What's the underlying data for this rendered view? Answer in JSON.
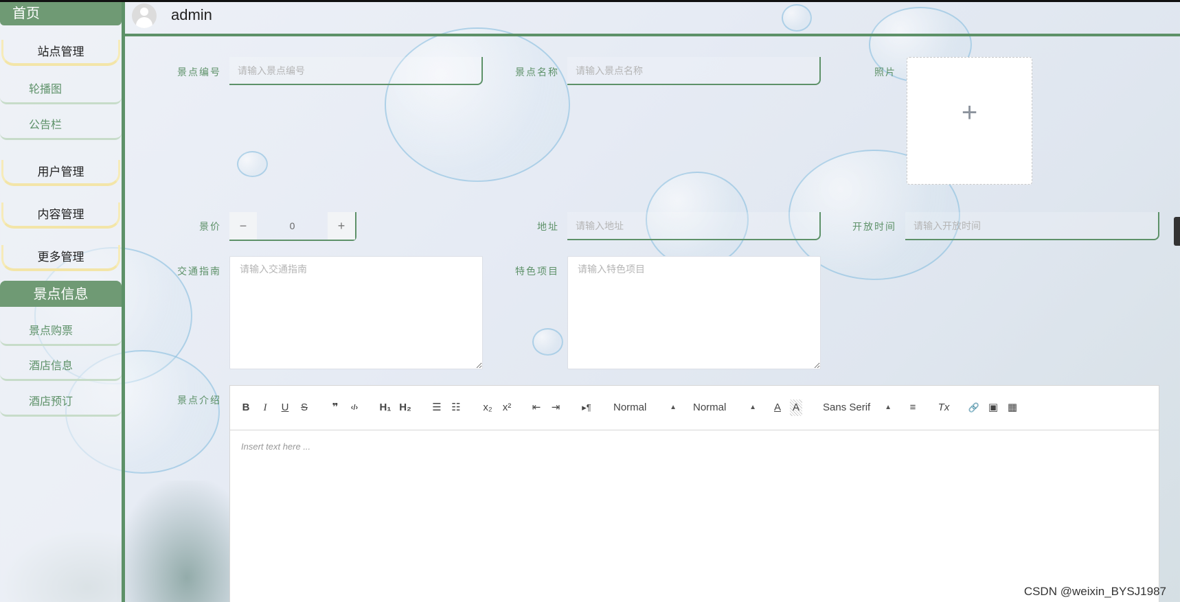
{
  "sidebar": {
    "home": "首页",
    "groups": [
      {
        "label": "站点管理",
        "items": [
          "轮播图",
          "公告栏"
        ]
      },
      {
        "label": "用户管理"
      },
      {
        "label": "内容管理"
      },
      {
        "label": "更多管理"
      }
    ],
    "active_section": "景点信息",
    "active_items": [
      "景点购票",
      "酒店信息",
      "酒店预订"
    ]
  },
  "header": {
    "username": "admin"
  },
  "form": {
    "id_label": "景点编号",
    "id_placeholder": "请输入景点编号",
    "name_label": "景点名称",
    "name_placeholder": "请输入景点名称",
    "photo_label": "照片",
    "photo_upload_icon": "+",
    "price_label": "景价",
    "price_value": "0",
    "price_minus": "−",
    "price_plus": "+",
    "address_label": "地址",
    "address_placeholder": "请输入地址",
    "hours_label": "开放时间",
    "hours_placeholder": "请输入开放时间",
    "traffic_label": "交通指南",
    "traffic_placeholder": "请输入交通指南",
    "feature_label": "特色项目",
    "feature_placeholder": "请输入特色项目",
    "intro_label": "景点介绍"
  },
  "editor": {
    "toolbar": {
      "bold": "B",
      "italic": "I",
      "underline": "U",
      "strike": "S",
      "quote": "❞",
      "code": "‹/›",
      "h1": "H₁",
      "h2": "H₂",
      "ordered_list": "☰",
      "bullet_list": "☷",
      "subscript": "x₂",
      "superscript": "x²",
      "outdent": "⇤",
      "indent": "⇥",
      "direction": "▸¶",
      "size_select": "Normal",
      "header_select": "Normal",
      "color": "A",
      "background": "A",
      "font_select": "Sans Serif",
      "align": "≡",
      "clean": "Tx",
      "link": "🔗",
      "image": "▣",
      "video": "▦"
    },
    "placeholder": "Insert text here ..."
  },
  "watermark": "CSDN @weixin_BYSJ1987"
}
